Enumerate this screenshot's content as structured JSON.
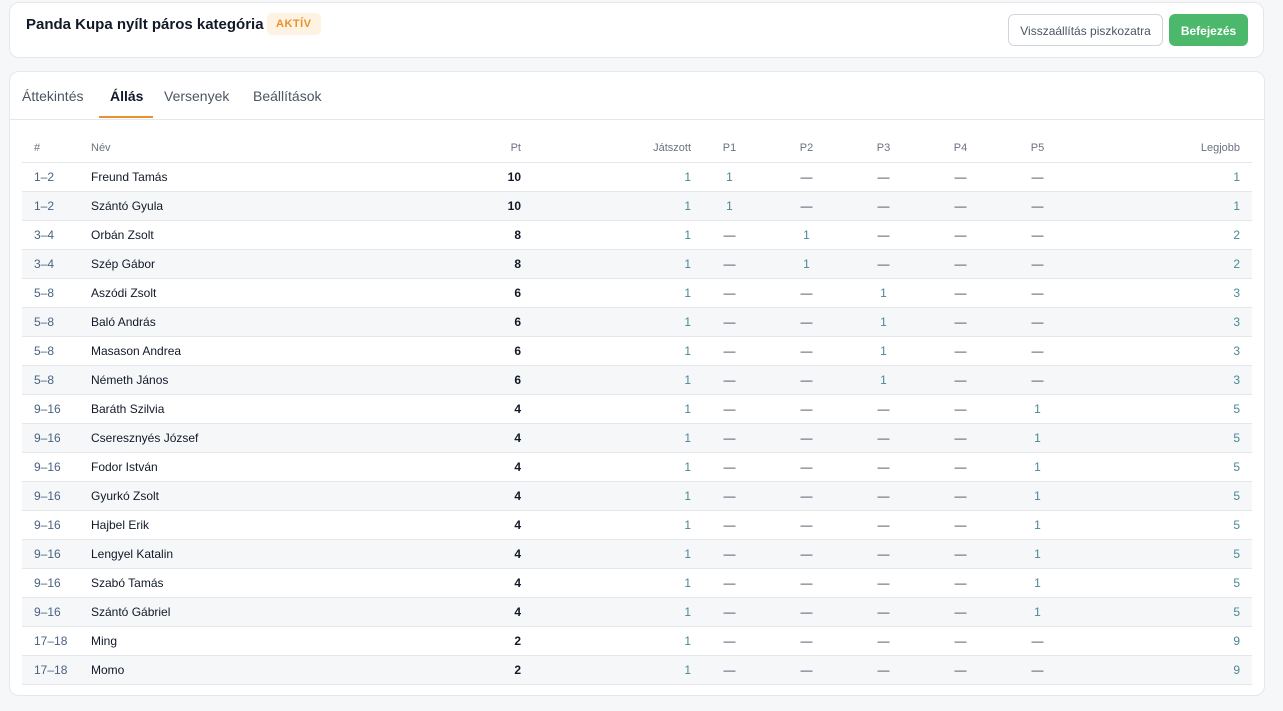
{
  "header": {
    "title": "Panda Kupa nyílt páros kategória",
    "status": "AKTÍV",
    "reset_label": "Visszaállítás piszkozatra",
    "finish_label": "Befejezés"
  },
  "tabs": [
    {
      "label": "Áttekintés",
      "active": false
    },
    {
      "label": "Állás",
      "active": true
    },
    {
      "label": "Versenyek",
      "active": false
    },
    {
      "label": "Beállítások",
      "active": false
    }
  ],
  "table": {
    "columns": [
      "#",
      "Név",
      "Pt",
      "Játszott",
      "P1",
      "P2",
      "P3",
      "P4",
      "P5",
      "Legjobb"
    ],
    "rows": [
      {
        "rank": "1–2",
        "name": "Freund Tamás",
        "pt": "10",
        "played": "1",
        "p1": "1",
        "p2": "—",
        "p3": "—",
        "p4": "—",
        "p5": "—",
        "best": "1"
      },
      {
        "rank": "1–2",
        "name": "Szántó Gyula",
        "pt": "10",
        "played": "1",
        "p1": "1",
        "p2": "—",
        "p3": "—",
        "p4": "—",
        "p5": "—",
        "best": "1"
      },
      {
        "rank": "3–4",
        "name": "Orbán Zsolt",
        "pt": "8",
        "played": "1",
        "p1": "—",
        "p2": "1",
        "p3": "—",
        "p4": "—",
        "p5": "—",
        "best": "2"
      },
      {
        "rank": "3–4",
        "name": "Szép Gábor",
        "pt": "8",
        "played": "1",
        "p1": "—",
        "p2": "1",
        "p3": "—",
        "p4": "—",
        "p5": "—",
        "best": "2"
      },
      {
        "rank": "5–8",
        "name": "Aszódi Zsolt",
        "pt": "6",
        "played": "1",
        "p1": "—",
        "p2": "—",
        "p3": "1",
        "p4": "—",
        "p5": "—",
        "best": "3"
      },
      {
        "rank": "5–8",
        "name": "Baló András",
        "pt": "6",
        "played": "1",
        "p1": "—",
        "p2": "—",
        "p3": "1",
        "p4": "—",
        "p5": "—",
        "best": "3"
      },
      {
        "rank": "5–8",
        "name": "Masason Andrea",
        "pt": "6",
        "played": "1",
        "p1": "—",
        "p2": "—",
        "p3": "1",
        "p4": "—",
        "p5": "—",
        "best": "3"
      },
      {
        "rank": "5–8",
        "name": "Németh János",
        "pt": "6",
        "played": "1",
        "p1": "—",
        "p2": "—",
        "p3": "1",
        "p4": "—",
        "p5": "—",
        "best": "3"
      },
      {
        "rank": "9–16",
        "name": "Baráth Szilvia",
        "pt": "4",
        "played": "1",
        "p1": "—",
        "p2": "—",
        "p3": "—",
        "p4": "—",
        "p5": "1",
        "best": "5"
      },
      {
        "rank": "9–16",
        "name": "Cseresznyés József",
        "pt": "4",
        "played": "1",
        "p1": "—",
        "p2": "—",
        "p3": "—",
        "p4": "—",
        "p5": "1",
        "best": "5"
      },
      {
        "rank": "9–16",
        "name": "Fodor István",
        "pt": "4",
        "played": "1",
        "p1": "—",
        "p2": "—",
        "p3": "—",
        "p4": "—",
        "p5": "1",
        "best": "5"
      },
      {
        "rank": "9–16",
        "name": "Gyurkó Zsolt",
        "pt": "4",
        "played": "1",
        "p1": "—",
        "p2": "—",
        "p3": "—",
        "p4": "—",
        "p5": "1",
        "best": "5"
      },
      {
        "rank": "9–16",
        "name": "Hajbel Erik",
        "pt": "4",
        "played": "1",
        "p1": "—",
        "p2": "—",
        "p3": "—",
        "p4": "—",
        "p5": "1",
        "best": "5"
      },
      {
        "rank": "9–16",
        "name": "Lengyel Katalin",
        "pt": "4",
        "played": "1",
        "p1": "—",
        "p2": "—",
        "p3": "—",
        "p4": "—",
        "p5": "1",
        "best": "5"
      },
      {
        "rank": "9–16",
        "name": "Szabó Tamás",
        "pt": "4",
        "played": "1",
        "p1": "—",
        "p2": "—",
        "p3": "—",
        "p4": "—",
        "p5": "1",
        "best": "5"
      },
      {
        "rank": "9–16",
        "name": "Szántó Gábriel",
        "pt": "4",
        "played": "1",
        "p1": "—",
        "p2": "—",
        "p3": "—",
        "p4": "—",
        "p5": "1",
        "best": "5"
      },
      {
        "rank": "17–18",
        "name": "Ming",
        "pt": "2",
        "played": "1",
        "p1": "—",
        "p2": "—",
        "p3": "—",
        "p4": "—",
        "p5": "—",
        "best": "9"
      },
      {
        "rank": "17–18",
        "name": "Momo",
        "pt": "2",
        "played": "1",
        "p1": "—",
        "p2": "—",
        "p3": "—",
        "p4": "—",
        "p5": "—",
        "best": "9"
      }
    ]
  },
  "colors": {
    "accent": "#e8912d",
    "success": "#4cb86b",
    "badge_bg": "#fef3e2"
  }
}
